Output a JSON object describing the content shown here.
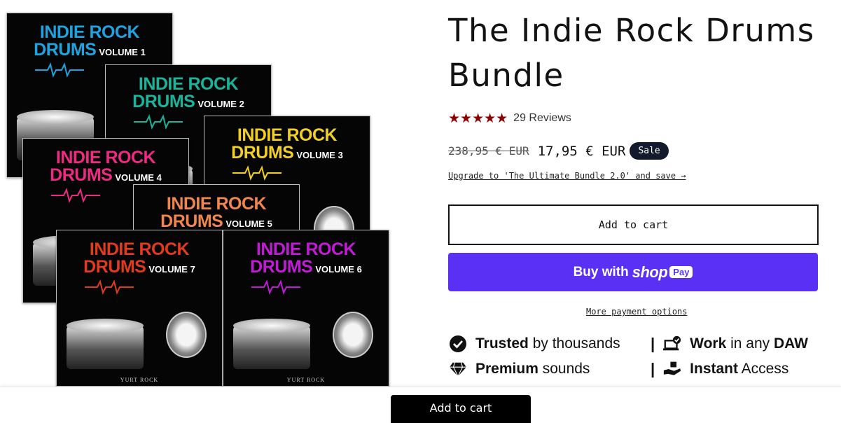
{
  "product": {
    "title": "The Indie Rock Drums Bundle",
    "rating_stars": "★★★★★",
    "reviews_label": "29 Reviews",
    "old_price": "238,95 € EUR",
    "new_price": "17,95 € EUR",
    "sale_badge": "Sale",
    "upgrade_link": "Upgrade to 'The Ultimate Bundle 2.0' and save →",
    "add_to_cart": "Add to cart",
    "shop_pay": {
      "buy_with": "Buy with",
      "shop": "shop",
      "pay": "Pay"
    },
    "more_payment": "More payment options"
  },
  "features": [
    {
      "icon": "check-circle-icon",
      "bold": "Trusted",
      "text": " by thousands"
    },
    {
      "icon": "laptop-check-icon",
      "bold": "Work",
      "text": " in any ",
      "bold2": "DAW"
    },
    {
      "icon": "diamond-icon",
      "bold": "Premium",
      "text": " sounds"
    },
    {
      "icon": "hand-box-icon",
      "bold": "Instant",
      "text": " Access"
    }
  ],
  "separator": "|",
  "gallery": {
    "title_line1": "INDIE ROCK",
    "title_line2": "DRUMS",
    "brand": "YURT ROCK",
    "covers": [
      {
        "volume": "VOLUME 1",
        "color": "#1fa3e0"
      },
      {
        "volume": "VOLUME 2",
        "color": "#19b49a"
      },
      {
        "volume": "VOLUME 3",
        "color": "#f2cf23"
      },
      {
        "volume": "VOLUME 4",
        "color": "#ee2a83"
      },
      {
        "volume": "VOLUME 5",
        "color": "#f0864d"
      },
      {
        "volume": "VOLUME 7",
        "color": "#e23a1c"
      },
      {
        "volume": "VOLUME 6",
        "color": "#c21bd6"
      }
    ]
  },
  "sticky": {
    "add_to_cart": "Add to cart"
  },
  "colors": {
    "star": "#8b0000",
    "shop_pay": "#5a31f4",
    "badge": "#121a2b"
  }
}
